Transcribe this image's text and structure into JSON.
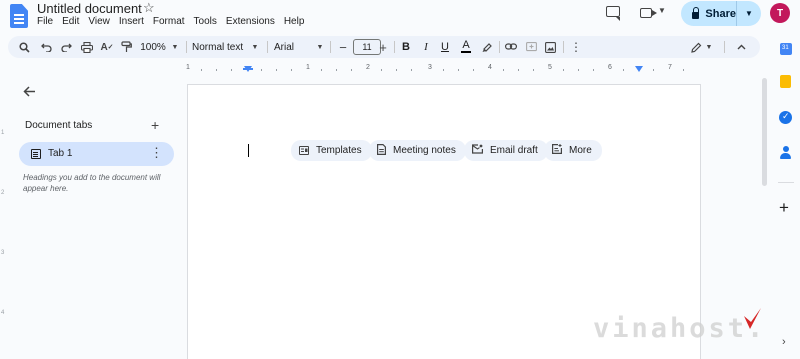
{
  "header": {
    "title": "Untitled document",
    "menu": [
      "File",
      "Edit",
      "View",
      "Insert",
      "Format",
      "Tools",
      "Extensions",
      "Help"
    ],
    "share_label": "Share",
    "avatar_initial": "T",
    "brand_color": "#4285f4"
  },
  "toolbar": {
    "zoom": "100%",
    "style": "Normal text",
    "font": "Arial",
    "font_size": "11",
    "minus": "−",
    "plus": "+",
    "bold": "B",
    "italic": "I",
    "underline_color": "A"
  },
  "ruler": {
    "ticks": [
      "1",
      "1",
      "2",
      "3",
      "4",
      "5",
      "6",
      "7"
    ]
  },
  "sidebar": {
    "title": "Document tabs",
    "tab": "Tab 1",
    "hint": "Headings you add to the document will appear here."
  },
  "page": {
    "chips": [
      "Templates",
      "Meeting notes",
      "Email draft",
      "More"
    ]
  },
  "watermark": {
    "text": "vinahost."
  }
}
